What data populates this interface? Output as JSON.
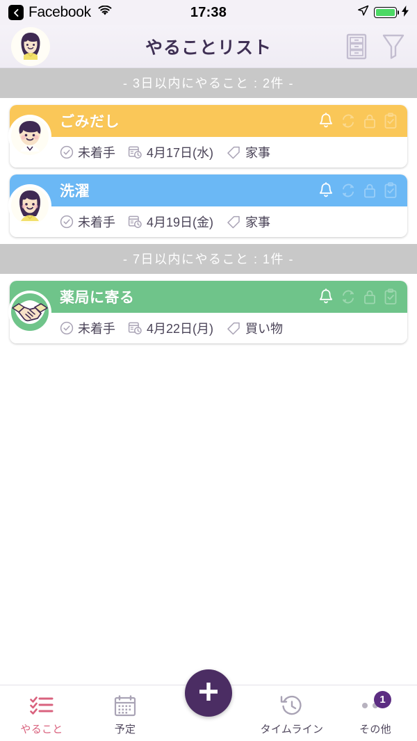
{
  "statusbar": {
    "back_app": "Facebook",
    "back_icon": "chevron-left-icon",
    "wifi_icon": "wifi-icon",
    "time": "17:38",
    "location_icon": "location-arrow-icon",
    "battery_icon": "battery-full-icon",
    "charging_icon": "lightning-bolt-icon",
    "battery_color": "#4cd964"
  },
  "navbar": {
    "avatar_icon": "user-avatar-woman-icon",
    "title": "やることリスト",
    "sort_icon": "drawer-list-icon",
    "filter_icon": "funnel-filter-icon",
    "icon_color": "#c3bdd0"
  },
  "sections": [
    {
      "header": "- 3日以内にやること : 2件 -",
      "tasks": [
        {
          "title": "ごみだし",
          "color": "#fac758",
          "avatar_icon": "avatar-boy-icon",
          "status": "未着手",
          "status_icon": "check-circle-icon",
          "date": "4月17日(水)",
          "date_icon": "schedule-clock-icon",
          "tag": "家事",
          "tag_icon": "tag-icon",
          "icons": [
            {
              "name": "bell-icon",
              "active": true
            },
            {
              "name": "repeat-icon",
              "active": false
            },
            {
              "name": "lock-icon",
              "active": false
            },
            {
              "name": "clipboard-check-icon",
              "active": false
            }
          ]
        },
        {
          "title": "洗濯",
          "color": "#6bb8f5",
          "avatar_icon": "avatar-woman-icon",
          "status": "未着手",
          "status_icon": "check-circle-icon",
          "date": "4月19日(金)",
          "date_icon": "schedule-clock-icon",
          "tag": "家事",
          "tag_icon": "tag-icon",
          "icons": [
            {
              "name": "bell-icon",
              "active": true
            },
            {
              "name": "repeat-icon",
              "active": false
            },
            {
              "name": "lock-icon",
              "active": false
            },
            {
              "name": "clipboard-check-icon",
              "active": false
            }
          ]
        }
      ]
    },
    {
      "header": "- 7日以内にやること : 1件 -",
      "tasks": [
        {
          "title": "薬局に寄る",
          "color": "#6fc48a",
          "avatar_icon": "avatar-handshake-icon",
          "status": "未着手",
          "status_icon": "check-circle-icon",
          "date": "4月22日(月)",
          "date_icon": "schedule-clock-icon",
          "tag": "買い物",
          "tag_icon": "tag-icon",
          "icons": [
            {
              "name": "bell-icon",
              "active": true
            },
            {
              "name": "repeat-icon",
              "active": false
            },
            {
              "name": "lock-icon",
              "active": false
            },
            {
              "name": "clipboard-check-icon",
              "active": false
            }
          ]
        }
      ]
    }
  ],
  "tabbar": {
    "active_color": "#d9627e",
    "fab": {
      "icon": "plus-icon",
      "color": "#4b2d63"
    },
    "items": [
      {
        "label": "やること",
        "icon": "checklist-icon",
        "active": true
      },
      {
        "label": "予定",
        "icon": "calendar-icon",
        "active": false
      },
      {
        "label": "タイムライン",
        "icon": "history-clock-icon",
        "active": false
      },
      {
        "label": "その他",
        "icon": "more-dots-icon",
        "active": false,
        "badge": "1"
      }
    ]
  }
}
